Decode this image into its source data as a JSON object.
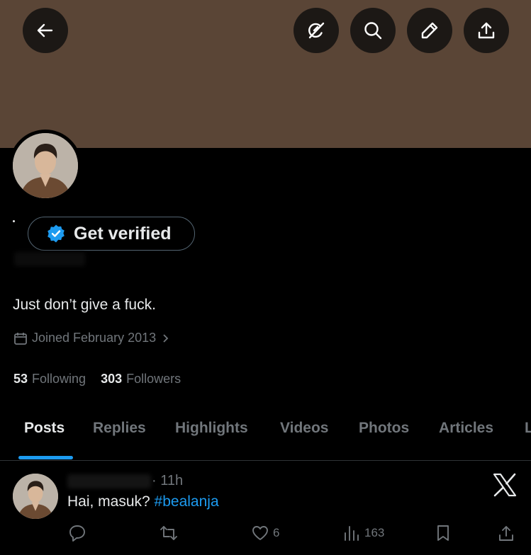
{
  "header": {
    "buttons": [
      "back-icon",
      "grok-icon",
      "search-icon",
      "edit-icon",
      "share-icon"
    ],
    "banner_color": "#5a4536"
  },
  "profile": {
    "verify_label": "Get verified",
    "bio": "Just don’t give a fuck.",
    "joined": "Joined February 2013",
    "following_count": "53",
    "following_label": "Following",
    "followers_count": "303",
    "followers_label": "Followers"
  },
  "tabs": [
    "Posts",
    "Replies",
    "Highlights",
    "Videos",
    "Photos",
    "Articles",
    "L"
  ],
  "active_tab": "Posts",
  "tweet": {
    "time": "· 11h",
    "text": "Hai, masuk? ",
    "hashtag": "#bealanja",
    "likes": "6",
    "views": "163"
  },
  "colors": {
    "accent": "#1d9bf0",
    "muted": "#71767b",
    "text": "#e7e9ea",
    "background": "#000000"
  }
}
